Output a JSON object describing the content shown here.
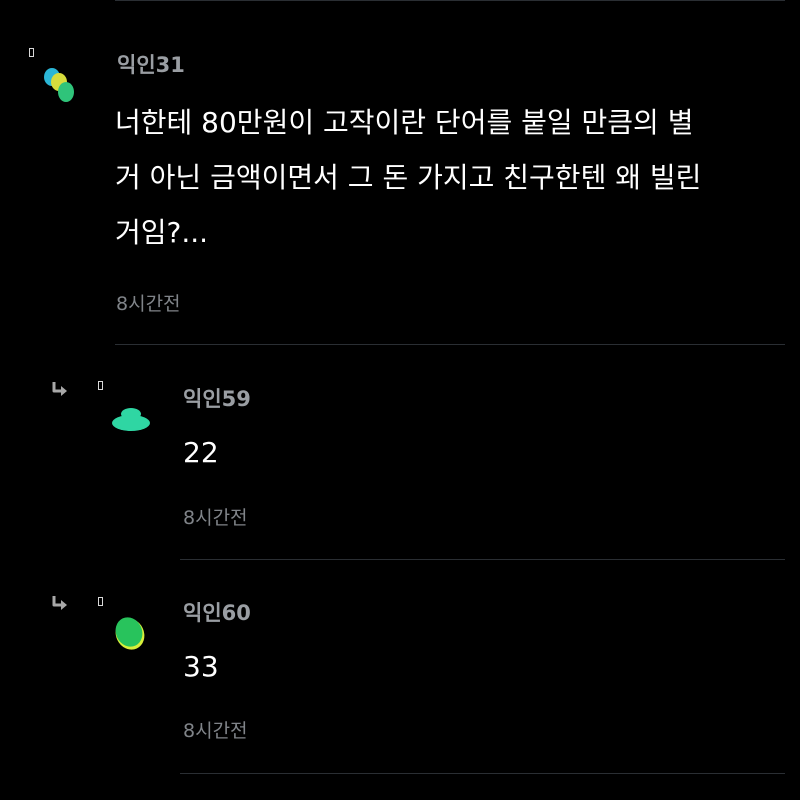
{
  "comments": [
    {
      "username": "익인31",
      "text_lines": [
        "너한테 80만원이 고작이란 단어를 붙일 만큼의 별",
        "거 아닌 금액이면서 그 돈 가지고 친구한텐 왜 빌린",
        "거임?..."
      ],
      "timestamp": "8시간전",
      "avatar_icon": "multicolor-blob-icon"
    }
  ],
  "replies": [
    {
      "username": "익인59",
      "text": "22",
      "timestamp": "8시간전",
      "avatar_icon": "teal-blob-icon",
      "avatar_color": "#2fd6a3"
    },
    {
      "username": "익인60",
      "text": "33",
      "timestamp": "8시간전",
      "avatar_icon": "green-blob-icon",
      "avatar_color": "#28c35c"
    }
  ],
  "colors": {
    "background": "#000000",
    "username": "#9a9ea3",
    "body_text": "#ffffff",
    "timestamp": "#808489",
    "divider": "#2a2e33"
  }
}
